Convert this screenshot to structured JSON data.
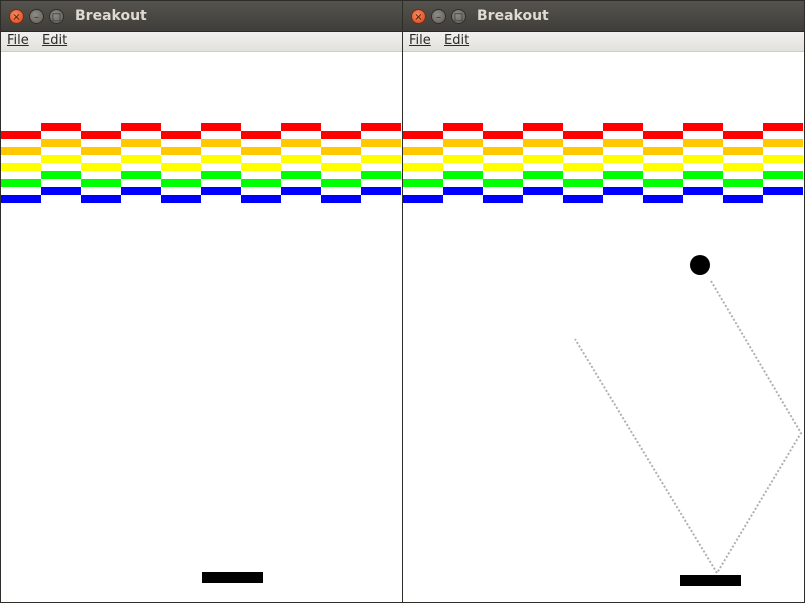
{
  "windows": [
    {
      "title": "Breakout",
      "menu": {
        "file": "File",
        "edit": "Edit"
      },
      "show_ball": false,
      "show_trail": false
    },
    {
      "title": "Breakout",
      "menu": {
        "file": "File",
        "edit": "Edit"
      },
      "show_ball": true,
      "show_trail": true
    }
  ],
  "window_buttons": {
    "close": "×",
    "minimize": "–",
    "maximize": "□"
  },
  "brick_rows": [
    {
      "color_name": "red",
      "color": "#ff0000"
    },
    {
      "color_name": "orange",
      "color": "#ffc800"
    },
    {
      "color_name": "yellow",
      "color": "#ffff00"
    },
    {
      "color_name": "green",
      "color": "#00ff00"
    },
    {
      "color_name": "blue",
      "color": "#0000ff"
    }
  ],
  "colors": {
    "paddle": "#000000",
    "ball": "#000000",
    "trail": "#b0b0b0",
    "background": "#ffffff"
  }
}
